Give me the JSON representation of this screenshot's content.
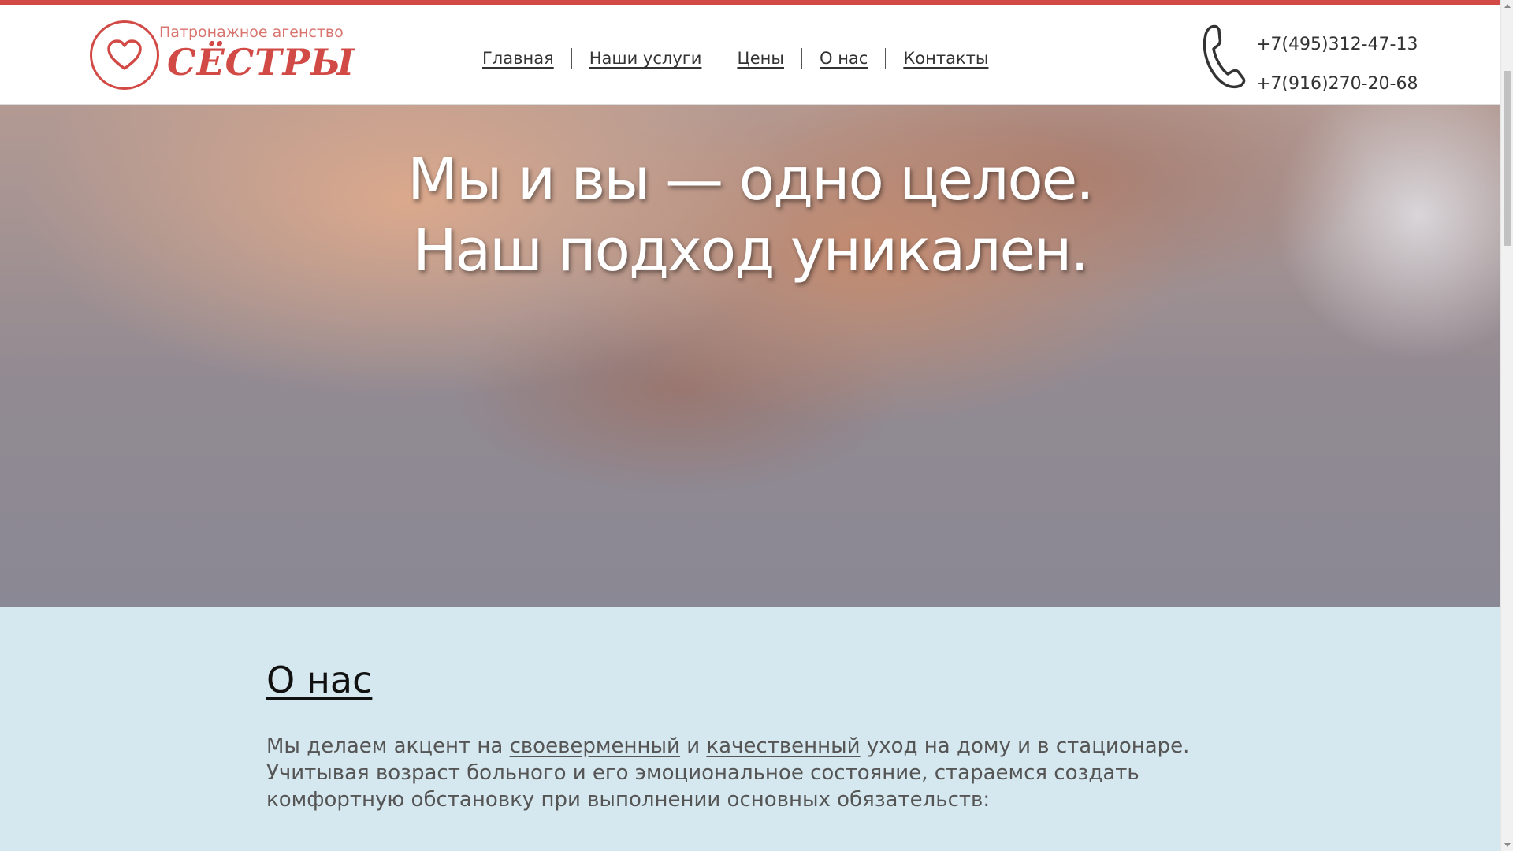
{
  "colors": {
    "accent": "#d24a45",
    "about_background": "#d6e8ef",
    "text": "#555555"
  },
  "logo": {
    "icon": "heart-icon",
    "subtitle": "Патронажное агенство",
    "name": "СЁСТРЫ"
  },
  "nav": {
    "items": [
      {
        "label": "Главная"
      },
      {
        "label": "Наши услуги"
      },
      {
        "label": "Цены"
      },
      {
        "label": "О нас"
      },
      {
        "label": "Контакты"
      }
    ]
  },
  "contacts": {
    "icon": "phone-icon",
    "phones": [
      "+7(495)312-47-13",
      "+7(916)270-20-68"
    ]
  },
  "hero": {
    "line1": "Мы и вы — одно целое.",
    "line2": "Наш подход уникален."
  },
  "about": {
    "title": "О нас",
    "text_part1": "Мы делаем акцент на ",
    "link1": "своеверменный",
    "text_part2": " и ",
    "link2": "качественный",
    "text_part3": " уход на дому и в стационаре. Учитывая возраст больного и его эмоциональное состояние, стараемся создать комфортную обстановку при выполнении основных обязательств:"
  }
}
